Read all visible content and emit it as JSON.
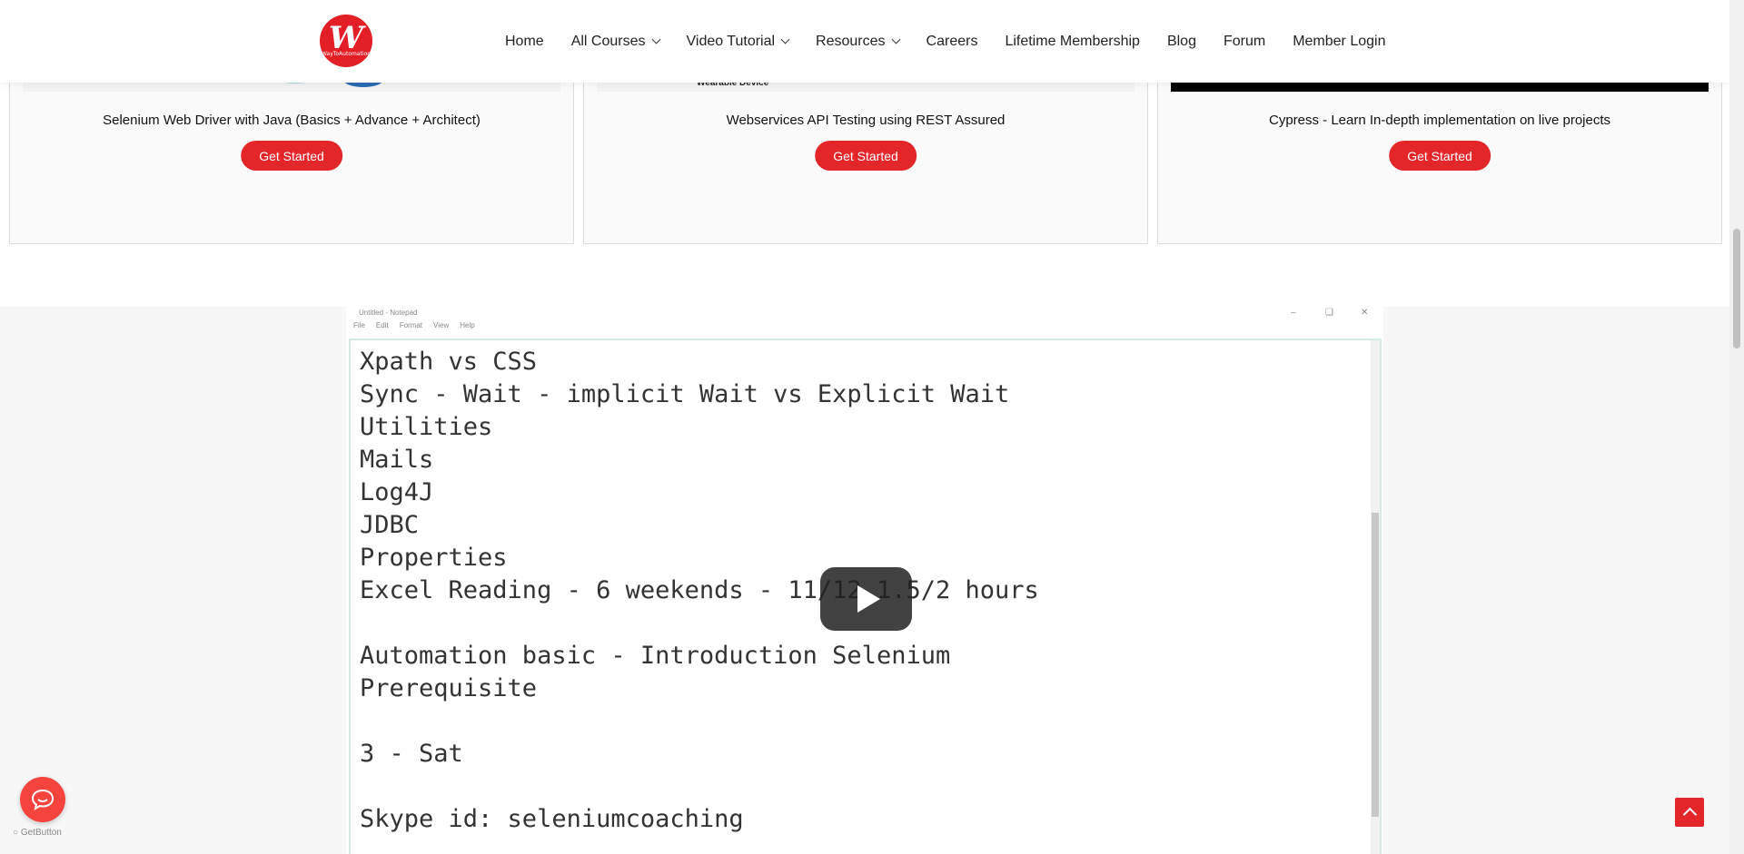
{
  "header": {
    "logo_text": "W",
    "logo_subtext": "WayToAutomation",
    "nav": [
      {
        "label": "Home",
        "dropdown": false
      },
      {
        "label": "All Courses",
        "dropdown": true
      },
      {
        "label": "Video Tutorial",
        "dropdown": true
      },
      {
        "label": "Resources",
        "dropdown": true
      },
      {
        "label": "Careers",
        "dropdown": false
      },
      {
        "label": "Lifetime Membership",
        "dropdown": false
      },
      {
        "label": "Blog",
        "dropdown": false
      },
      {
        "label": "Forum",
        "dropdown": false
      },
      {
        "label": "Member Login",
        "dropdown": false
      }
    ]
  },
  "cards": [
    {
      "title": "Selenium Web Driver with Java (Basics + Advance + Architect)",
      "button": "Get Started",
      "image_caption": ""
    },
    {
      "title": "Webservices API Testing using REST Assured",
      "button": "Get Started",
      "image_caption": "Wearable Device"
    },
    {
      "title": "Cypress - Learn In-depth implementation on live projects",
      "button": "Get Started",
      "image_caption": ""
    }
  ],
  "video": {
    "notepad_title": "Untitled - Notepad",
    "notepad_menu": [
      "File",
      "Edit",
      "Format",
      "View",
      "Help"
    ],
    "lines": [
      "Xpath vs CSS",
      "Sync - Wait - implicit Wait vs Explicit Wait",
      "Utilities",
      "Mails",
      "Log4J",
      "JDBC",
      "Properties",
      "Excel Reading - 6 weekends - 11/12 1.5/2 hours",
      "",
      "Automation basic - Introduction Selenium",
      "Prerequisite",
      "",
      "3 - Sat",
      "",
      "Skype id: seleniumcoaching"
    ]
  },
  "widgets": {
    "getbutton_label": "GetButton"
  },
  "colors": {
    "accent": "#e3262a",
    "chat": "#f4443d"
  }
}
